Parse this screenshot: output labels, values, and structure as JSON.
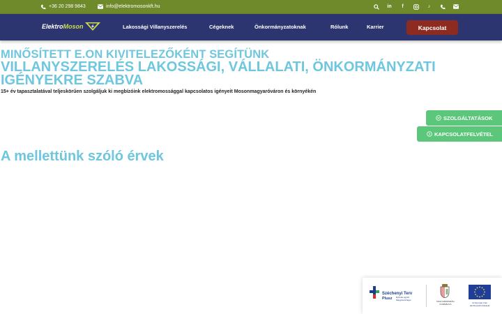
{
  "topbar": {
    "phone": "+36 20 298 9843",
    "email": "info@elektromosonkft.hu",
    "icons": [
      "search-icon",
      "linkedin-icon",
      "facebook-icon",
      "instagram-icon",
      "tiktok-icon",
      "phone-icon",
      "email-icon"
    ]
  },
  "nav": {
    "logo_main": "Elektro",
    "logo_accent": "Moson",
    "items": [
      "Lakossági Villanyszerelés",
      "Cégeknek",
      "Önkormányzatoknak",
      "Rólunk",
      "Karrier"
    ],
    "cta": "Kapcsolat"
  },
  "hero": {
    "line1": "MINŐSÍTETT E.ON KIVITELEZŐKÉNT SEGÍTÜNK",
    "line2": "VILLANYSZERELÉS LAKOSSÁGI, VÁLLALATI, ÖNKORMÁNYZATI IGÉNYEKRE SZABVA",
    "subtitle": "15+ év tapasztalatával teljeskörűen szolgáljuk ki megbízóink elektromossággal kapcsolatos igényeit Mosonmagyaróváron és környékén"
  },
  "floating": {
    "btn1": "SZOLGÁLTATÁSOK",
    "btn2": "KAPCSOLATFELVÉTEL"
  },
  "section": {
    "title": "A mellettünk szóló érvek"
  },
  "funding": {
    "szechenyi_title": "Széchenyi Terv",
    "szechenyi_plus": "Plusz",
    "szechenyi_tag": "Építsük együtt Magyarországot",
    "kormany": "MAGYARORSZÁG KORMÁNYA",
    "eu": "Az Európai Unió társfinanszírozásával"
  },
  "colors": {
    "topbar": "#6e8a2a",
    "nav": "#2d3570",
    "cta": "#8e2b20",
    "heading": "#6ec6df",
    "floating": "#5cc77a"
  }
}
